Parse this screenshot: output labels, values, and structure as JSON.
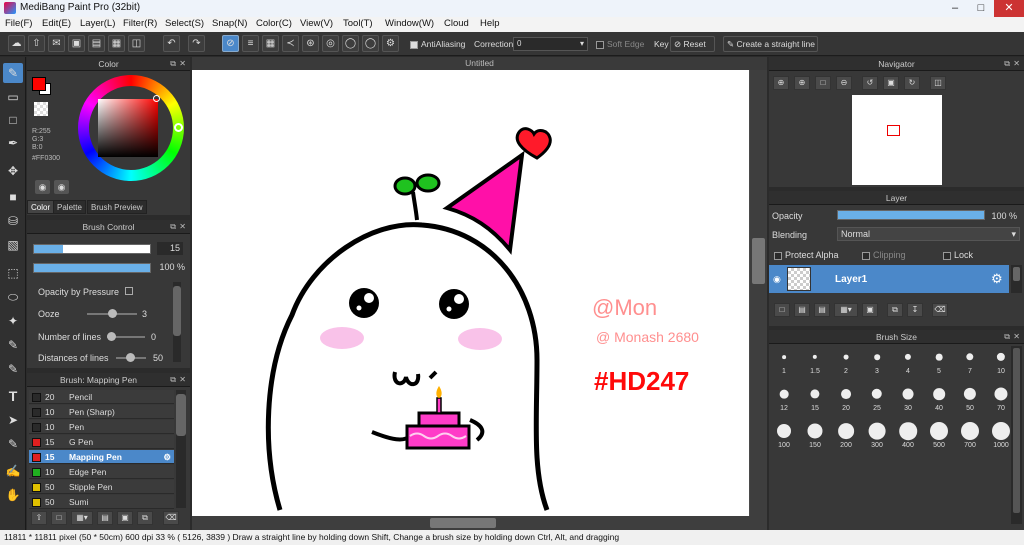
{
  "app": {
    "title": "MediBang Paint Pro (32bit)"
  },
  "menu": [
    "File(F)",
    "Edit(E)",
    "Layer(L)",
    "Filter(R)",
    "Select(S)",
    "Snap(N)",
    "Color(C)",
    "View(V)",
    "Tool(T)",
    "Window(W)",
    "Cloud",
    "Help"
  ],
  "toolbar": {
    "antialiasing": "AntiAliasing",
    "correction_label": "Correction",
    "correction_value": "0",
    "soft_edge": "Soft Edge",
    "key": "Key",
    "reset": "Reset",
    "straight_line": "Create a straight line"
  },
  "color_panel": {
    "title": "Color",
    "r": "R:255",
    "g": "G:3",
    "b": "B:0",
    "hex": "#FF0300",
    "tabs": [
      "Color",
      "Palette",
      "Brush Preview"
    ],
    "primary_color": "#ff0300"
  },
  "brush_control": {
    "title": "Brush Control",
    "width_value": "15",
    "opacity_value": "100 %",
    "opacity_by_pressure": "Opacity by Pressure",
    "ooze_label": "Ooze",
    "ooze_value": "3",
    "lines_label": "Number of lines",
    "lines_value": "0",
    "distance_label": "Distances of lines",
    "distance_value": "50"
  },
  "brush_list": {
    "title": "Brush: Mapping Pen",
    "items": [
      {
        "size": "20",
        "name": "Pencil",
        "color": "#2a2a2a"
      },
      {
        "size": "10",
        "name": "Pen (Sharp)",
        "color": "#2a2a2a"
      },
      {
        "size": "10",
        "name": "Pen",
        "color": "#2a2a2a"
      },
      {
        "size": "15",
        "name": "G Pen",
        "color": "#e02020"
      },
      {
        "size": "15",
        "name": "Mapping Pen",
        "color": "#e02020"
      },
      {
        "size": "10",
        "name": "Edge Pen",
        "color": "#20b020"
      },
      {
        "size": "50",
        "name": "Stipple Pen",
        "color": "#e0c000"
      },
      {
        "size": "50",
        "name": "Sumi",
        "color": "#e0c000"
      }
    ]
  },
  "canvas": {
    "tab_title": "Untitled",
    "signature1": "@Mon",
    "signature2": "@ Monash 2680",
    "tag": "#HD247"
  },
  "navigator": {
    "title": "Navigator"
  },
  "layer_panel": {
    "title": "Layer",
    "opacity_label": "Opacity",
    "opacity_value": "100 %",
    "blending_label": "Blending",
    "blending_value": "Normal",
    "protect_alpha": "Protect Alpha",
    "clipping": "Clipping",
    "lock": "Lock",
    "layer_name": "Layer1"
  },
  "brush_size": {
    "title": "Brush Size",
    "sizes": [
      "1",
      "1.5",
      "2",
      "3",
      "4",
      "5",
      "7",
      "10",
      "12",
      "15",
      "20",
      "25",
      "30",
      "40",
      "50",
      "70",
      "100",
      "150",
      "200",
      "300",
      "400",
      "500",
      "700",
      "1000"
    ]
  },
  "status": {
    "text": "11811 * 11811 pixel   (50 * 50cm)   600 dpi   33 %   ( 5126, 3839 )   Draw a straight line by holding down Shift, Change a brush size by holding down Ctrl, Alt, and dragging"
  }
}
